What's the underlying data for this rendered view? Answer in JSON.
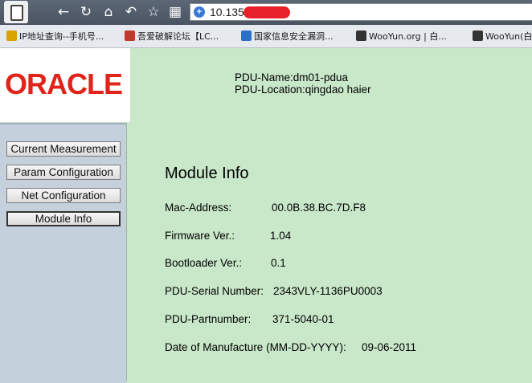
{
  "browser": {
    "url": "10.135",
    "bookmarks": [
      {
        "label": "IP地址查询--手机号...",
        "color": "#d9a400"
      },
      {
        "label": "吾爱破解论坛【LC...",
        "color": "#c0392b"
      },
      {
        "label": "国家信息安全漏洞...",
        "color": "#2c6fc9"
      },
      {
        "label": "WooYun.org | 白...",
        "color": "#333333"
      },
      {
        "label": "WooYun(白",
        "color": "#333333"
      }
    ]
  },
  "logo": {
    "text": "ORACLE"
  },
  "pdu": {
    "name_line": "PDU-Name:dm01-pdua",
    "location_line": "PDU-Location:qingdao haier"
  },
  "sidebar": {
    "items": [
      {
        "label": "Current Measurement"
      },
      {
        "label": "Param Configuration"
      },
      {
        "label": "Net Configuration"
      },
      {
        "label": "Module Info"
      }
    ]
  },
  "module": {
    "title": "Module Info",
    "rows": [
      {
        "label": "Mac-Address:",
        "value": "00.0B.38.BC.7D.F8"
      },
      {
        "label": "Firmware Ver.:",
        "value": "1.04"
      },
      {
        "label": "Bootloader Ver.:",
        "value": "0.1"
      },
      {
        "label": "PDU-Serial Number:",
        "value": "2343VLY-1136PU0003"
      },
      {
        "label": "PDU-Partnumber:",
        "value": "371-5040-01"
      },
      {
        "label": "Date of Manufacture (MM-DD-YYYY):",
        "value": "09-06-2011"
      }
    ]
  }
}
